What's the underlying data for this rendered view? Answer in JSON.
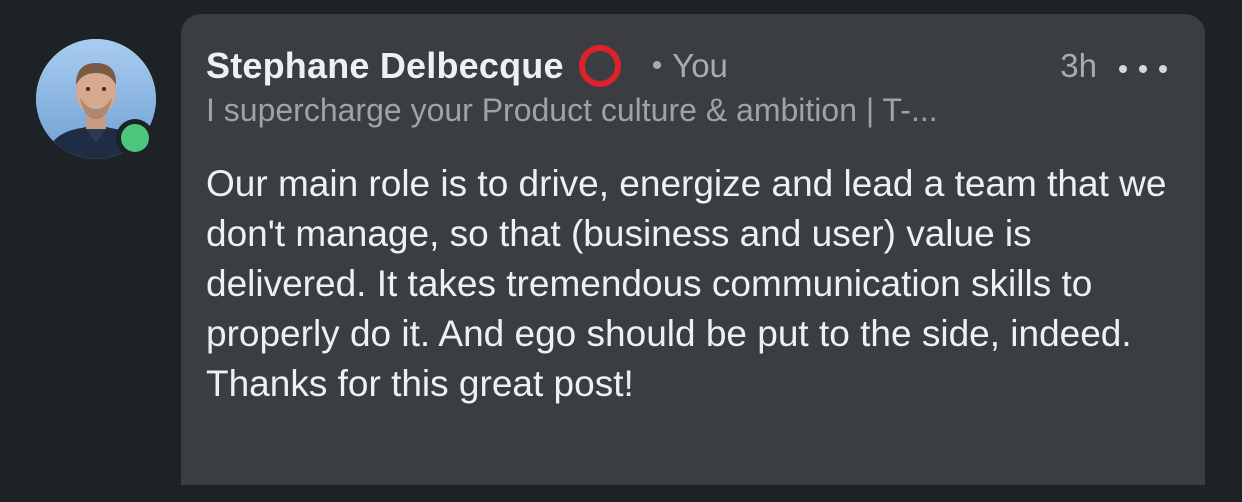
{
  "comment": {
    "author": {
      "name": "Stephane Delbecque",
      "badge_icon": "open-to-work-circle-icon",
      "badge_color": "#e0202a",
      "relationship": "You",
      "headline": "I supercharge your Product culture & ambition | T-...",
      "presence_color": "#4cc77a"
    },
    "timestamp": "3h",
    "separator": "•",
    "more_icon": "more-options-icon",
    "text": "Our main role is to drive, energize and lead a team that we don't manage, so that (business and user) value is delivered. It takes tremendous communication skills to properly do it. And ego should be put to the side, indeed. Thanks for this great post!"
  },
  "theme": {
    "background": "#1d2226",
    "bubble": "#3a3e42"
  }
}
